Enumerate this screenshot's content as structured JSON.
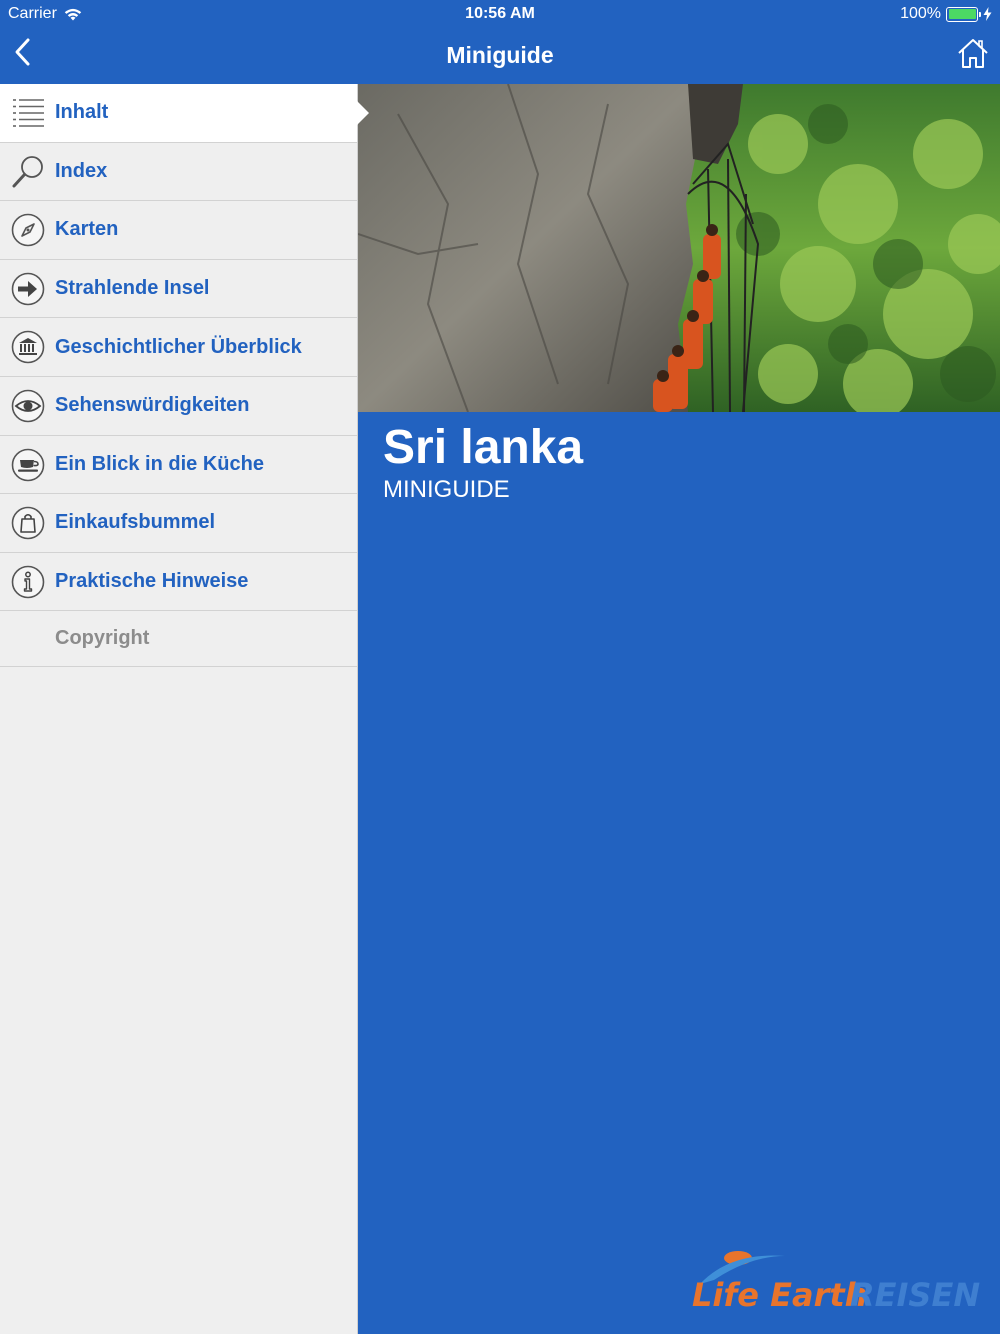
{
  "status_bar": {
    "carrier": "Carrier",
    "time": "10:56 AM",
    "battery": "100%"
  },
  "nav": {
    "title": "Miniguide"
  },
  "sidebar": {
    "items": [
      {
        "label": "Inhalt",
        "icon": "list-icon"
      },
      {
        "label": "Index",
        "icon": "magnifier-icon"
      },
      {
        "label": "Karten",
        "icon": "compass-icon"
      },
      {
        "label": "Strahlende Insel",
        "icon": "arrow-right-icon"
      },
      {
        "label": "Geschichtlicher Überblick",
        "icon": "museum-icon"
      },
      {
        "label": "Sehenswürdigkeiten",
        "icon": "eye-icon"
      },
      {
        "label": "Ein Blick in die Küche",
        "icon": "food-icon"
      },
      {
        "label": "Einkaufsbummel",
        "icon": "shopping-bag-icon"
      },
      {
        "label": "Praktische Hinweise",
        "icon": "info-icon"
      },
      {
        "label": "Copyright",
        "icon": ""
      }
    ]
  },
  "cover": {
    "title": "Sri lanka",
    "subtitle": "MINIGUIDE"
  },
  "logo": {
    "text_1": "Life Earth",
    "text_2": "REISEN"
  },
  "colors": {
    "brand_blue": "#2262c0",
    "sidebar_bg": "#efefef",
    "logo_orange": "#e8742c"
  }
}
